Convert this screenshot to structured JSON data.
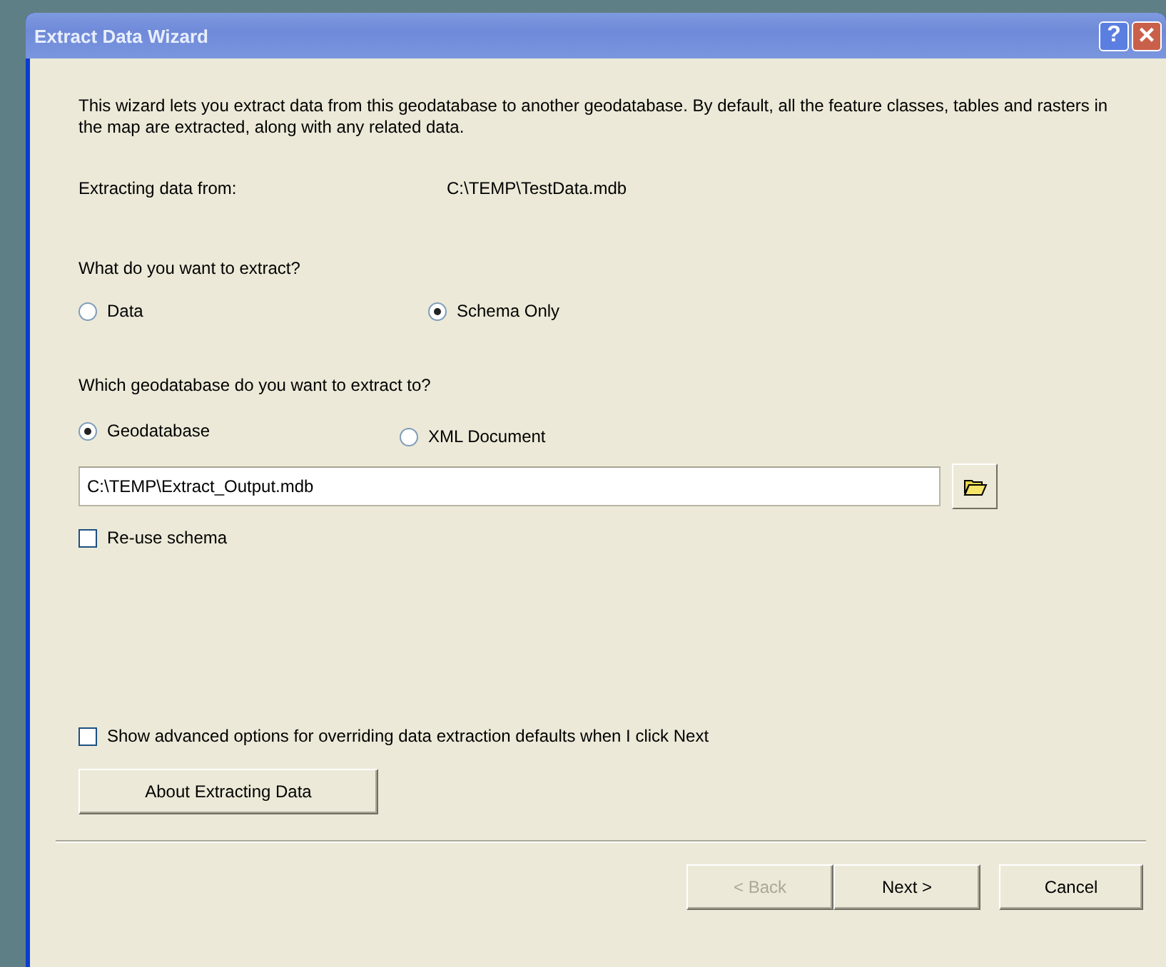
{
  "window": {
    "title": "Extract Data Wizard",
    "help_button": "?",
    "close_button": "×"
  },
  "intro": "This wizard lets you extract data from this geodatabase to another geodatabase. By default, all the feature classes, tables and rasters in the map are extracted, along with any related data.",
  "source": {
    "label": "Extracting data from:",
    "value": "C:\\TEMP\\TestData.mdb"
  },
  "extract_question": "What do you want to extract?",
  "extract_options": [
    {
      "label": "Data",
      "selected": false
    },
    {
      "label": "Schema Only",
      "selected": true
    }
  ],
  "target_question": "Which geodatabase do you want to extract to?",
  "target_options": [
    {
      "label": "Geodatabase",
      "selected": true
    },
    {
      "label": "XML Document",
      "selected": false
    }
  ],
  "output_path": {
    "value": "C:\\TEMP\\Extract_Output.mdb"
  },
  "reuse_schema": {
    "label": "Re-use schema",
    "checked": false
  },
  "advanced_options": {
    "label": "Show advanced options for overriding data extraction defaults when I click Next",
    "checked": false
  },
  "about_button": "About Extracting Data",
  "buttons": [
    {
      "label": "< Back",
      "disabled": true
    },
    {
      "label": "Next >",
      "disabled": false
    },
    {
      "label": "Cancel",
      "disabled": false
    }
  ]
}
